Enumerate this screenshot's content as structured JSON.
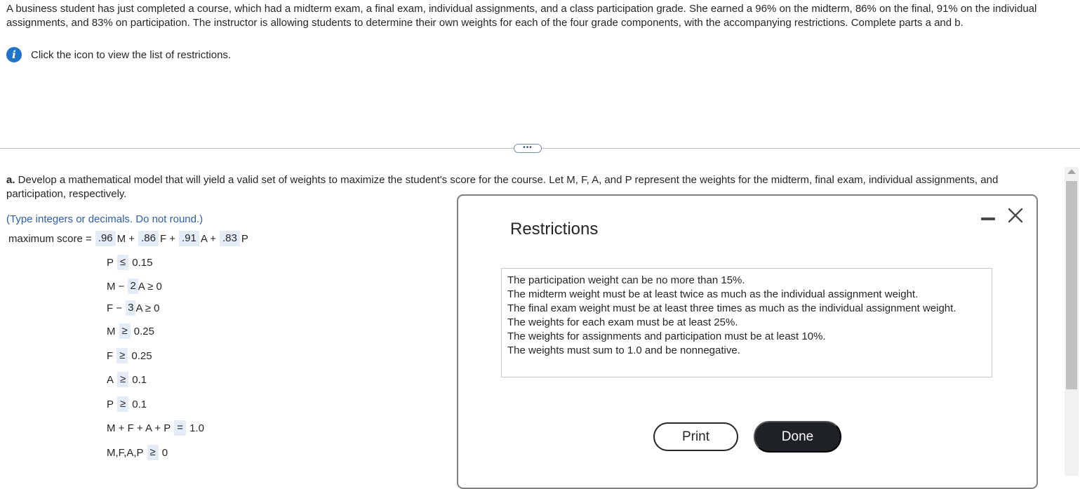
{
  "question": {
    "text": "A business student has just completed a course, which had a midterm exam, a final exam, individual assignments, and a class participation grade. She earned a 96% on the midterm, 86% on the final, 91% on the individual assignments, and 83% on participation. The instructor is allowing students to determine their own weights for each of the four grade components, with the accompanying restrictions. Complete parts a and b.",
    "info_icon": "info-icon",
    "info_text": "Click the icon to view the list of restrictions."
  },
  "divider": {
    "ellipsis_label": "•••"
  },
  "part_a": {
    "label": "a.",
    "text": " Develop a mathematical model that will yield a valid set of weights to maximize the student's score for the course. Let M, F, A, and P represent the weights for the midterm, final exam, individual assignments, and participation, respectively.",
    "hint": "(Type integers or decimals. Do not round.)",
    "objective": {
      "label": "maximum score =",
      "terms": [
        {
          "coef": ".96",
          "var": "M +"
        },
        {
          "coef": ".86",
          "var": "F +"
        },
        {
          "coef": ".91",
          "var": "A +"
        },
        {
          "coef": ".83",
          "var": "P"
        }
      ]
    },
    "constraints": [
      {
        "lhs": "P",
        "op": "≤",
        "rhs": "0.15"
      },
      {
        "lhs": "M −",
        "coef": "2",
        "lhs2": "A ≥ 0"
      },
      {
        "lhs": "F −",
        "coef": "3",
        "lhs2": "A ≥ 0"
      },
      {
        "lhs": "M",
        "op": "≥",
        "rhs": "0.25"
      },
      {
        "lhs": "F",
        "op": "≥",
        "rhs": "0.25"
      },
      {
        "lhs": "A",
        "op": "≥",
        "rhs": "0.1"
      },
      {
        "lhs": "P",
        "op": "≥",
        "rhs": "0.1"
      },
      {
        "lhs": "M + F + A + P",
        "op": "=",
        "rhs": "1.0"
      },
      {
        "lhs": "M,F,A,P",
        "op": "≥",
        "rhs": "0"
      }
    ]
  },
  "modal": {
    "title": "Restrictions",
    "restrictions": [
      "The participation weight can be no more than 15%.",
      "The midterm weight must be at least twice as much as the individual assignment weight.",
      "The final exam weight must be at least three times as much as the individual assignment weight.",
      "The weights for each exam must be at least 25%.",
      "The weights for assignments and participation must be at least 10%.",
      "The weights must sum to 1.0 and be nonnegative."
    ],
    "print_label": "Print",
    "done_label": "Done"
  },
  "colors": {
    "info_icon": "#1f73c9",
    "hint_text": "#2b5fab",
    "answer_box": "#e4ecf7",
    "done_button": "#1e2126"
  }
}
